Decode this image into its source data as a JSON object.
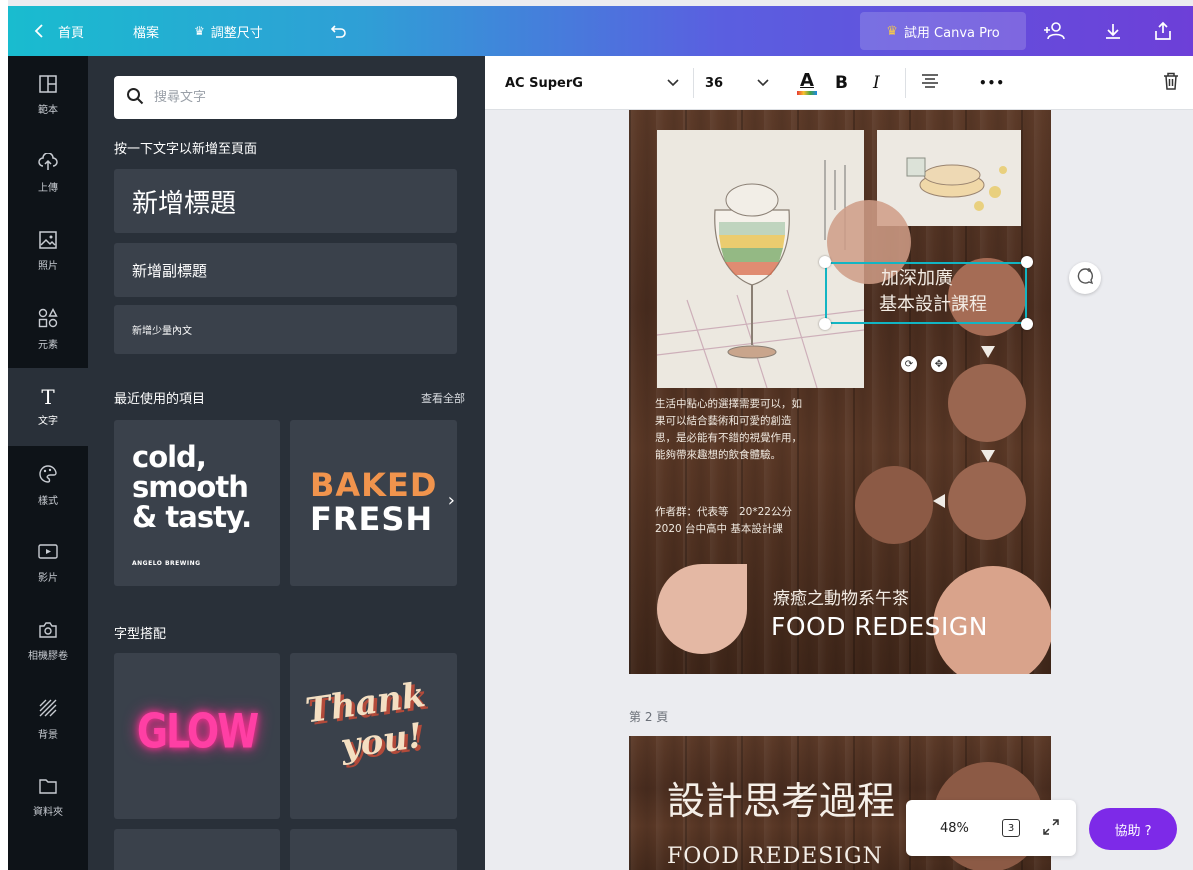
{
  "topbar": {
    "home": "首頁",
    "file": "檔案",
    "resize": "調整尺寸",
    "try_pro": "試用 Canva Pro"
  },
  "rail": {
    "items": [
      {
        "label": "範本",
        "icon": "template-icon"
      },
      {
        "label": "上傳",
        "icon": "upload-cloud-icon"
      },
      {
        "label": "照片",
        "icon": "photo-icon"
      },
      {
        "label": "元素",
        "icon": "elements-icon"
      },
      {
        "label": "文字",
        "icon": "text-icon"
      },
      {
        "label": "樣式",
        "icon": "palette-icon"
      },
      {
        "label": "影片",
        "icon": "video-icon"
      },
      {
        "label": "相機膠卷",
        "icon": "camera-icon"
      },
      {
        "label": "背景",
        "icon": "background-icon"
      },
      {
        "label": "資料夾",
        "icon": "folder-icon"
      }
    ]
  },
  "panel": {
    "search_placeholder": "搜尋文字",
    "click_to_add": "按一下文字以新增至頁面",
    "add_heading": "新增標題",
    "add_subheading": "新增副標題",
    "add_body": "新增少量內文",
    "recent_title": "最近使用的項目",
    "see_all": "查看全部",
    "recent_tiles": [
      {
        "lines": [
          "cold,",
          "smooth",
          "& tasty."
        ],
        "small": "ANGELO BREWING"
      },
      {
        "lines": [
          "BAKED",
          "FRESH"
        ]
      }
    ],
    "font_combos_title": "字型搭配",
    "combo_tiles": [
      {
        "text": "GLOW"
      },
      {
        "lines": [
          "Thank",
          "you!"
        ]
      }
    ]
  },
  "toolbar": {
    "font": "AC SuperG",
    "size": "36",
    "text_color": "#f0c24b",
    "bold": "B",
    "italic": "I",
    "more": "•••"
  },
  "design": {
    "selected_text": [
      "加深加廣",
      "基本設計課程"
    ],
    "body": [
      "生活中點心的選擇需要可以，如",
      "果可以結合藝術和可愛的創造",
      "思，是必能有不錯的視覺作用，",
      "能夠帶來趣想的飲食體驗。"
    ],
    "credits": [
      "作者群：代表等　20*22公分",
      "2020 台中高中 基本設計課"
    ],
    "subtitle_cn": "療癒之動物系午茶",
    "subtitle_en": "FOOD REDESIGN",
    "page2_label": "第 2 頁",
    "page2_title": "設計思考過程",
    "page2_sub": "FOOD REDESIGN"
  },
  "footer": {
    "zoom": "48%",
    "page_count": "3",
    "help": "協助 ?"
  },
  "colors": {
    "rail_bg": "#0e1318",
    "panel_bg": "#293039",
    "tile_bg": "#3a414b",
    "accent_purple": "#7d2ae8",
    "selection": "#12b5c3",
    "circle_brown": "#9a6650",
    "circle_peach": "#d9a38b"
  }
}
